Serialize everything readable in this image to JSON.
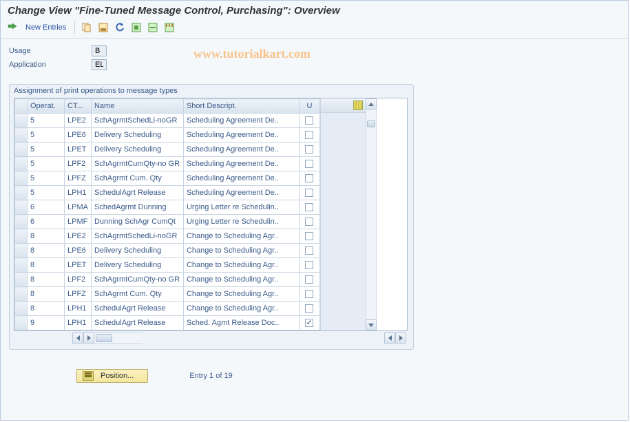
{
  "title": "Change View \"Fine-Tuned Message Control, Purchasing\": Overview",
  "watermark": "www.tutorialkart.com",
  "toolbar": {
    "new_entries": "New Entries"
  },
  "form": {
    "usage_label": "Usage",
    "usage_value": "B",
    "application_label": "Application",
    "application_value": "EL"
  },
  "panel_title": "Assignment of print operations to message types",
  "columns": {
    "operat": "Operat.",
    "ct": "CT...",
    "name": "Name",
    "short": "Short Descript.",
    "u": "U"
  },
  "rows": [
    {
      "op": "5",
      "ct": "LPE2",
      "name": "SchAgrmtSchedLi-noGR",
      "short": "Scheduling Agreement De..",
      "u": false
    },
    {
      "op": "5",
      "ct": "LPE6",
      "name": "Delivery Scheduling",
      "short": "Scheduling Agreement De..",
      "u": false
    },
    {
      "op": "5",
      "ct": "LPET",
      "name": "Delivery Scheduling",
      "short": "Scheduling Agreement De..",
      "u": false
    },
    {
      "op": "5",
      "ct": "LPF2",
      "name": "SchAgrmtCumQty-no GR",
      "short": "Scheduling Agreement De..",
      "u": false
    },
    {
      "op": "5",
      "ct": "LPFZ",
      "name": "SchAgrmt Cum. Qty",
      "short": "Scheduling Agreement De..",
      "u": false
    },
    {
      "op": "5",
      "ct": "LPH1",
      "name": "SchedulAgrt Release",
      "short": "Scheduling Agreement De..",
      "u": false
    },
    {
      "op": "6",
      "ct": "LPMA",
      "name": "SchedAgrmt Dunning",
      "short": "Urging Letter re Schedulin..",
      "u": false
    },
    {
      "op": "6",
      "ct": "LPMF",
      "name": "Dunning SchAgr CumQt",
      "short": "Urging Letter re Schedulin..",
      "u": false
    },
    {
      "op": "8",
      "ct": "LPE2",
      "name": "SchAgrmtSchedLi-noGR",
      "short": "Change to Scheduling Agr..",
      "u": false
    },
    {
      "op": "8",
      "ct": "LPE6",
      "name": "Delivery Scheduling",
      "short": "Change to Scheduling Agr..",
      "u": false
    },
    {
      "op": "8",
      "ct": "LPET",
      "name": "Delivery Scheduling",
      "short": "Change to Scheduling Agr..",
      "u": false
    },
    {
      "op": "8",
      "ct": "LPF2",
      "name": "SchAgrmtCumQty-no GR",
      "short": "Change to Scheduling Agr..",
      "u": false
    },
    {
      "op": "8",
      "ct": "LPFZ",
      "name": "SchAgrmt Cum. Qty",
      "short": "Change to Scheduling Agr..",
      "u": false
    },
    {
      "op": "8",
      "ct": "LPH1",
      "name": "SchedulAgrt Release",
      "short": "Change to Scheduling Agr..",
      "u": false
    },
    {
      "op": "9",
      "ct": "LPH1",
      "name": "SchedulAgrt Release",
      "short": "Sched. Agmt Release Doc..",
      "u": true
    }
  ],
  "footer": {
    "position_label": "Position...",
    "entry_label": "Entry 1 of 19"
  }
}
